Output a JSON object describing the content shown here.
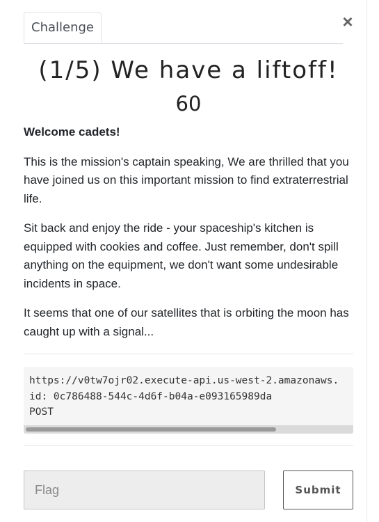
{
  "modal": {
    "tab_label": "Challenge",
    "close_glyph": "×"
  },
  "challenge": {
    "title": "(1/5) We have a liftoff!",
    "points": "60",
    "greeting": "Welcome cadets!",
    "paragraphs": [
      "This is the mission's captain speaking, We are thrilled that you have joined us on this important mission to find extraterrestrial life.",
      "Sit back and enjoy the ride - your spaceship's kitchen is equipped with cookies and coffee. Just remember, don't spill anything on the equipment, we don't want some undesirable incidents in space.",
      "It seems that one of our satellites that is orbiting the moon has caught up with a signal..."
    ],
    "code_lines": [
      "https://v0tw7ojr02.execute-api.us-west-2.amazonaws.",
      "id: 0c786488-544c-4d6f-b04a-e093165989da",
      "POST"
    ]
  },
  "form": {
    "flag_placeholder": "Flag",
    "flag_value": "",
    "submit_label": "Submit"
  }
}
